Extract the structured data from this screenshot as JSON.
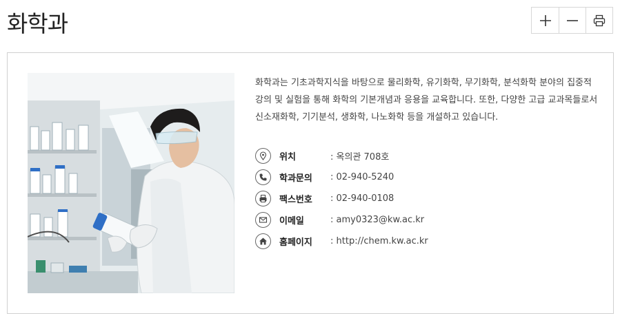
{
  "page": {
    "title": "화학과"
  },
  "toolbar": {
    "zoom_in": {
      "icon": "plus-icon"
    },
    "zoom_out": {
      "icon": "minus-icon"
    },
    "print": {
      "icon": "printer-icon"
    }
  },
  "department": {
    "description": "화학과는 기초과학지식을 바탕으로 물리화학, 유기화학, 무기화학, 분석화학 분야의 집중적 강의 및 실험을 통해 화학의 기본개념과 응용을 교육합니다. 또한, 다양한 고급 교과목들로서 신소재화학, 기기분석, 생화학, 나노화학 등을 개설하고 있습니다.",
    "info": [
      {
        "label": "위치",
        "value": ": 옥의관 708호",
        "icon": "location-pin-icon"
      },
      {
        "label": "학과문의",
        "value": ": 02-940-5240",
        "icon": "phone-icon"
      },
      {
        "label": "팩스번호",
        "value": ": 02-940-0108",
        "icon": "fax-icon"
      },
      {
        "label": "이메일",
        "value": ": amy0323@kw.ac.kr",
        "icon": "mail-icon"
      },
      {
        "label": "홈페이지",
        "value": ": http://chem.kw.ac.kr",
        "icon": "home-icon"
      }
    ]
  },
  "colors": {
    "border": "#d0d0d0",
    "text": "#444444",
    "label": "#222222"
  }
}
